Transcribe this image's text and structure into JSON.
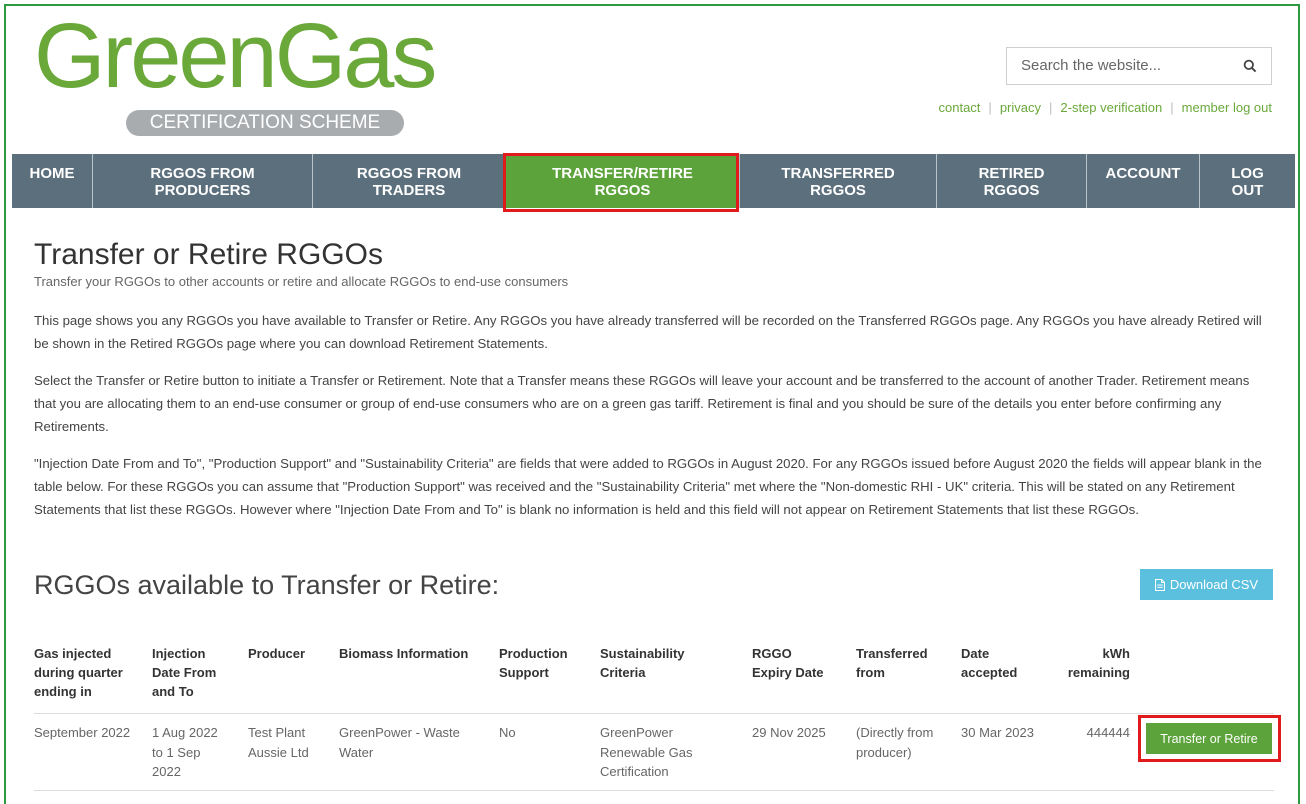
{
  "logo": {
    "word": "GreenGas",
    "tagline": "CERTIFICATION SCHEME"
  },
  "search": {
    "placeholder": "Search the website..."
  },
  "toplinks": [
    "contact",
    "privacy",
    "2-step verification",
    "member log out"
  ],
  "nav": [
    {
      "label": "HOME",
      "active": false
    },
    {
      "label": "RGGOS FROM PRODUCERS",
      "active": false
    },
    {
      "label": "RGGOS FROM TRADERS",
      "active": false
    },
    {
      "label": "TRANSFER/RETIRE RGGOS",
      "active": true
    },
    {
      "label": "TRANSFERRED RGGOS",
      "active": false
    },
    {
      "label": "RETIRED RGGOS",
      "active": false
    },
    {
      "label": "ACCOUNT",
      "active": false
    },
    {
      "label": "LOG OUT",
      "active": false
    }
  ],
  "page": {
    "title": "Transfer or Retire RGGOs",
    "subtitle": "Transfer your RGGOs to other accounts or retire and allocate RGGOs to end-use consumers",
    "para1": "This page shows you any RGGOs you have available to Transfer or Retire. Any RGGOs you have already transferred will be recorded on the Transferred RGGOs page. Any RGGOs you have already Retired will be shown in the Retired RGGOs page where you can download Retirement Statements.",
    "para2": "Select the Transfer or Retire button to initiate a Transfer or Retirement. Note that a Transfer means these RGGOs will leave your account and be transferred to the account of another Trader. Retirement means that you are allocating them to an end-use consumer or group of end-use consumers who are on a green gas tariff. Retirement is final and you should be sure of the details you enter before confirming any Retirements.",
    "para3": "\"Injection Date From and To\", \"Production Support\" and \"Sustainability Criteria\" are fields that were added to RGGOs in August 2020. For any RGGOs issued before August 2020 the fields will appear blank in the table below. For these RGGOs you can assume that \"Production Support\" was received and the \"Sustainability Criteria\" met where the \"Non-domestic RHI - UK\" criteria. This will be stated on any Retirement Statements that list these RGGOs. However where \"Injection Date From and To\" is blank no information is held and this field will not appear on Retirement Statements that list these RGGOs.",
    "section_title": "RGGOs available to Transfer or Retire:",
    "download_label": "Download CSV"
  },
  "table": {
    "headers": [
      "Gas injected during quarter ending in",
      "Injection Date From and To",
      "Producer",
      "Biomass Information",
      "Production Support",
      "Sustainability Criteria",
      "RGGO Expiry Date",
      "Transferred from",
      "Date accepted",
      "kWh remaining"
    ],
    "rows": [
      {
        "quarter": "September 2022",
        "injection": "1 Aug 2022 to 1 Sep 2022",
        "producer": "Test Plant Aussie Ltd",
        "biomass": "GreenPower - Waste Water",
        "support": "No",
        "criteria": "GreenPower Renewable Gas Certification",
        "expiry": "29 Nov 2025",
        "transferred": "(Directly from producer)",
        "accepted": "30 Mar 2023",
        "kwh": "444444",
        "action": "Transfer or Retire"
      }
    ]
  },
  "colors": {
    "brand_green": "#6aa83a",
    "nav_bg": "#5c6f7d",
    "nav_active": "#5da33b",
    "highlight": "#e11b1b",
    "csv_btn": "#5bc0de"
  }
}
